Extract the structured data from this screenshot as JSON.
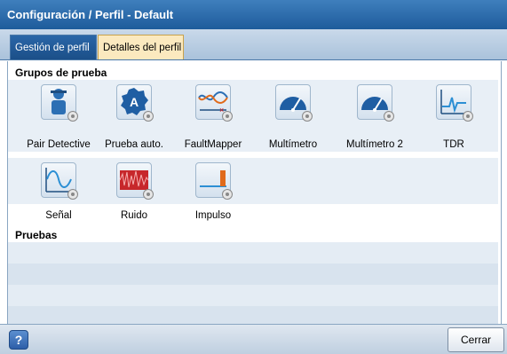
{
  "window": {
    "title": "Configuración / Perfil - Default"
  },
  "tabs": [
    {
      "label": "Gestión de perfil"
    },
    {
      "label": "Detalles del perfil"
    }
  ],
  "sections": {
    "test_groups": "Grupos de prueba",
    "tests": "Pruebas"
  },
  "test_groups": [
    {
      "label": "Pair Detective",
      "icon": "pair-detective-icon"
    },
    {
      "label": "Prueba auto.",
      "icon": "auto-test-icon"
    },
    {
      "label": "FaultMapper",
      "icon": "faultmapper-icon"
    },
    {
      "label": "Multímetro",
      "icon": "multimeter-icon"
    },
    {
      "label": "Multímetro 2",
      "icon": "multimeter-2-icon"
    },
    {
      "label": "TDR",
      "icon": "tdr-icon"
    },
    {
      "label": "Señal",
      "icon": "signal-icon"
    },
    {
      "label": "Ruido",
      "icon": "noise-icon"
    },
    {
      "label": "Impulso",
      "icon": "impulse-icon"
    }
  ],
  "footer": {
    "help": "?",
    "close": "Cerrar"
  }
}
